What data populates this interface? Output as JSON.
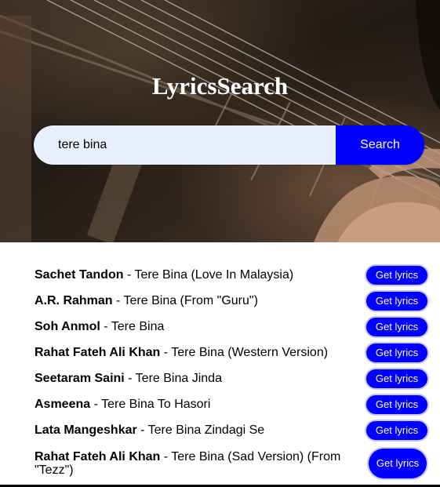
{
  "app": {
    "title": "LyricsSearch"
  },
  "search": {
    "value": "tere bina",
    "placeholder": "",
    "button_label": "Search"
  },
  "results": [
    {
      "artist": "Sachet Tandon",
      "title": "Tere Bina (Love In Malaysia)",
      "button": "Get lyrics"
    },
    {
      "artist": "A.R. Rahman",
      "title": "Tere Bina (From \"Guru\")",
      "button": "Get lyrics"
    },
    {
      "artist": "Soh Anmol",
      "title": "Tere Bina",
      "button": "Get lyrics"
    },
    {
      "artist": "Rahat Fateh Ali Khan",
      "title": "Tere Bina (Western Version)",
      "button": "Get lyrics"
    },
    {
      "artist": "Seetaram Saini",
      "title": "Tere Bina Jinda",
      "button": "Get lyrics"
    },
    {
      "artist": "Asmeena",
      "title": "Tere Bina To Hasori",
      "button": "Get lyrics"
    },
    {
      "artist": "Lata Mangeshkar",
      "title": "Tere Bina Zindagi Se",
      "button": "Get lyrics"
    },
    {
      "artist": "Rahat Fateh Ali Khan",
      "title": "Tere Bina (Sad Version) (From \"Tezz\")",
      "button": "Get lyrics"
    }
  ],
  "separator": " - ",
  "colors": {
    "accent": "#0000ff",
    "input_bg": "#e8f0fe"
  }
}
